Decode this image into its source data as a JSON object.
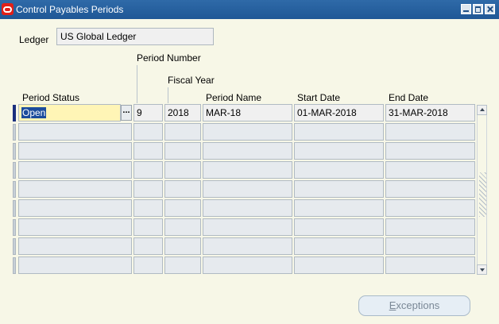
{
  "window": {
    "title": "Control Payables Periods"
  },
  "ledger": {
    "label": "Ledger",
    "value": "US Global Ledger"
  },
  "columns": {
    "period_status": "Period Status",
    "period_number": "Period Number",
    "fiscal_year": "Fiscal Year",
    "period_name": "Period Name",
    "start_date": "Start Date",
    "end_date": "End Date"
  },
  "rows": [
    {
      "period_status": "Open",
      "period_number": "9",
      "fiscal_year": "2018",
      "period_name": "MAR-18",
      "start_date": "01-MAR-2018",
      "end_date": "31-MAR-2018"
    },
    {
      "period_status": "",
      "period_number": "",
      "fiscal_year": "",
      "period_name": "",
      "start_date": "",
      "end_date": ""
    },
    {
      "period_status": "",
      "period_number": "",
      "fiscal_year": "",
      "period_name": "",
      "start_date": "",
      "end_date": ""
    },
    {
      "period_status": "",
      "period_number": "",
      "fiscal_year": "",
      "period_name": "",
      "start_date": "",
      "end_date": ""
    },
    {
      "period_status": "",
      "period_number": "",
      "fiscal_year": "",
      "period_name": "",
      "start_date": "",
      "end_date": ""
    },
    {
      "period_status": "",
      "period_number": "",
      "fiscal_year": "",
      "period_name": "",
      "start_date": "",
      "end_date": ""
    },
    {
      "period_status": "",
      "period_number": "",
      "fiscal_year": "",
      "period_name": "",
      "start_date": "",
      "end_date": ""
    },
    {
      "period_status": "",
      "period_number": "",
      "fiscal_year": "",
      "period_name": "",
      "start_date": "",
      "end_date": ""
    },
    {
      "period_status": "",
      "period_number": "",
      "fiscal_year": "",
      "period_name": "",
      "start_date": "",
      "end_date": ""
    }
  ],
  "lov_button": "...",
  "exceptions_button": {
    "mnemonic": "E",
    "rest": "xceptions"
  },
  "colors": {
    "title_bar": "#1F5796",
    "background": "#F7F7E7",
    "focused_cell": "#FFF5B6",
    "selection": "#1C4C9C",
    "active_row_marker": "#1B2F7E"
  }
}
